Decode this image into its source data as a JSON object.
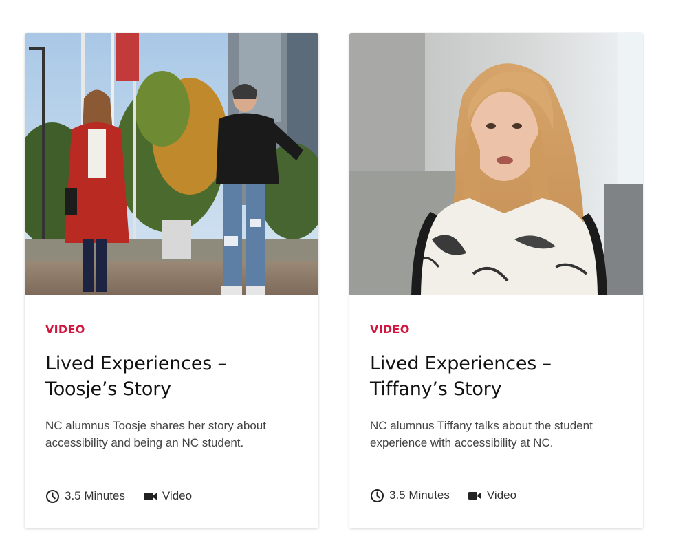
{
  "cards": [
    {
      "category": "VIDEO",
      "title": "Lived Experiences – Toosje’s Story",
      "description": "NC alumnus Toosje shares her story about accessibility and being an NC student.",
      "duration": "3.5 Minutes",
      "media_type": "Video",
      "duration_icon": "clock-icon",
      "media_icon": "video-camera-icon"
    },
    {
      "category": "VIDEO",
      "title": "Lived Experiences – Tiffany’s Story",
      "description": "NC alumnus Tiffany talks about the student experience with accessibility at NC.",
      "duration": "3.5 Minutes",
      "media_type": "Video",
      "duration_icon": "clock-icon",
      "media_icon": "video-camera-icon"
    }
  ],
  "colors": {
    "category_accent": "#d3163f",
    "title_text": "#111111",
    "body_text": "#444444"
  }
}
